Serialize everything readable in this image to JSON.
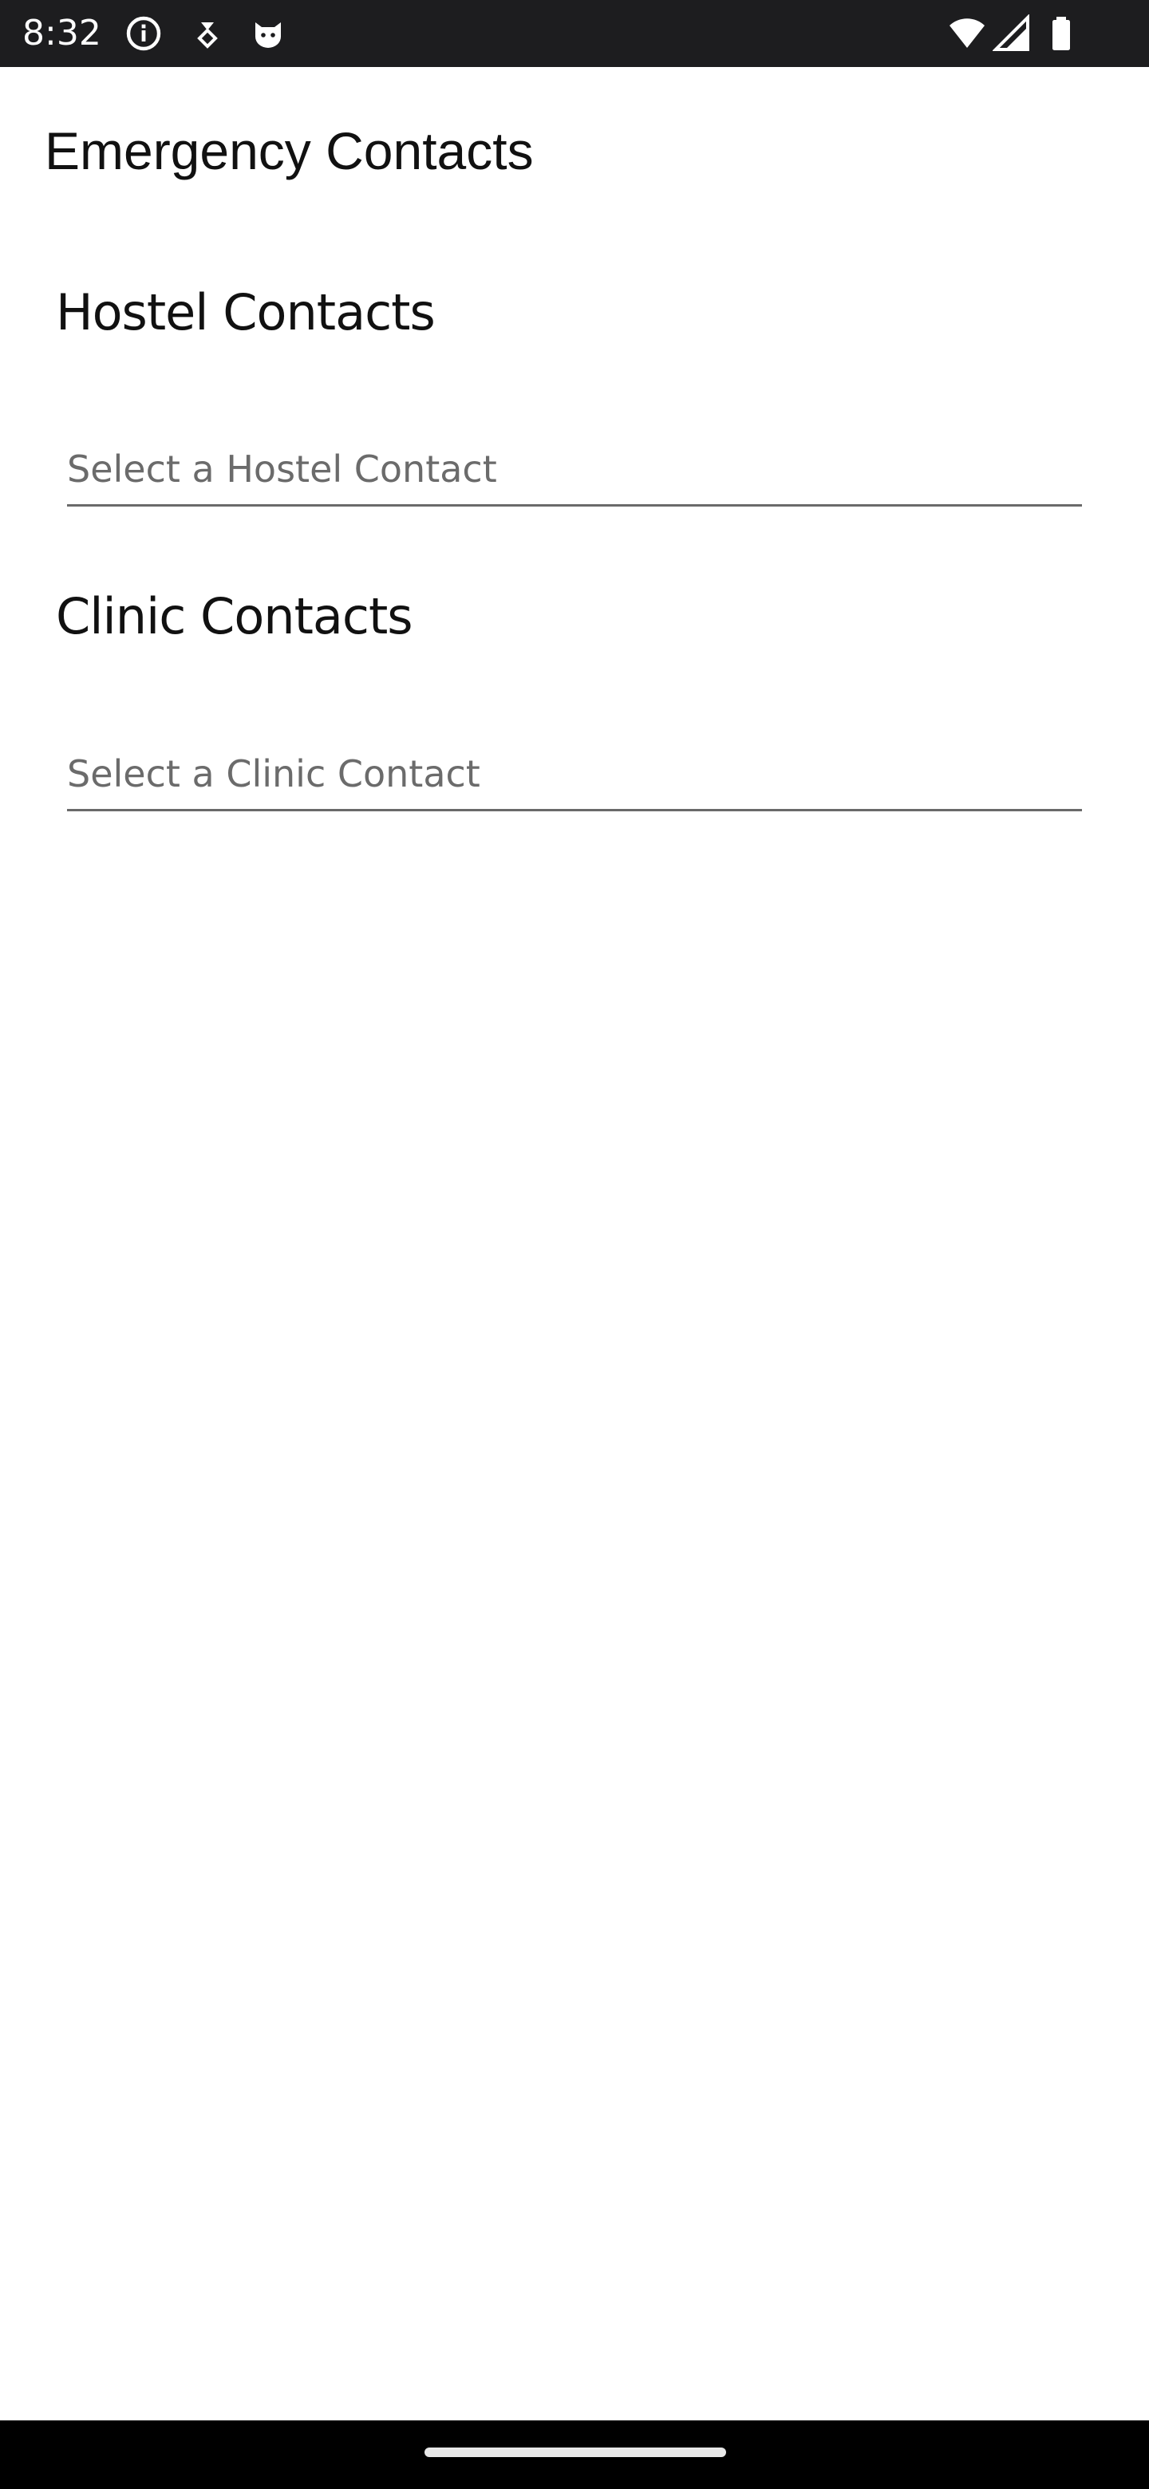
{
  "status_bar": {
    "time": "8:32",
    "icons_left": [
      "info-icon",
      "download-icon",
      "cat-icon"
    ],
    "icons_right": [
      "wifi-icon",
      "signal-icon",
      "battery-icon"
    ]
  },
  "app_bar": {
    "title": "Emergency Contacts"
  },
  "sections": [
    {
      "heading": "Hostel Contacts",
      "select_placeholder": "Select a Hostel Contact"
    },
    {
      "heading": "Clinic Contacts",
      "select_placeholder": "Select a Clinic Contact"
    }
  ],
  "colors": {
    "status_bar_bg": "#1d1d1f",
    "background": "#ffffff",
    "placeholder_text": "#6b6b6b",
    "underline": "#6a6a6a"
  }
}
